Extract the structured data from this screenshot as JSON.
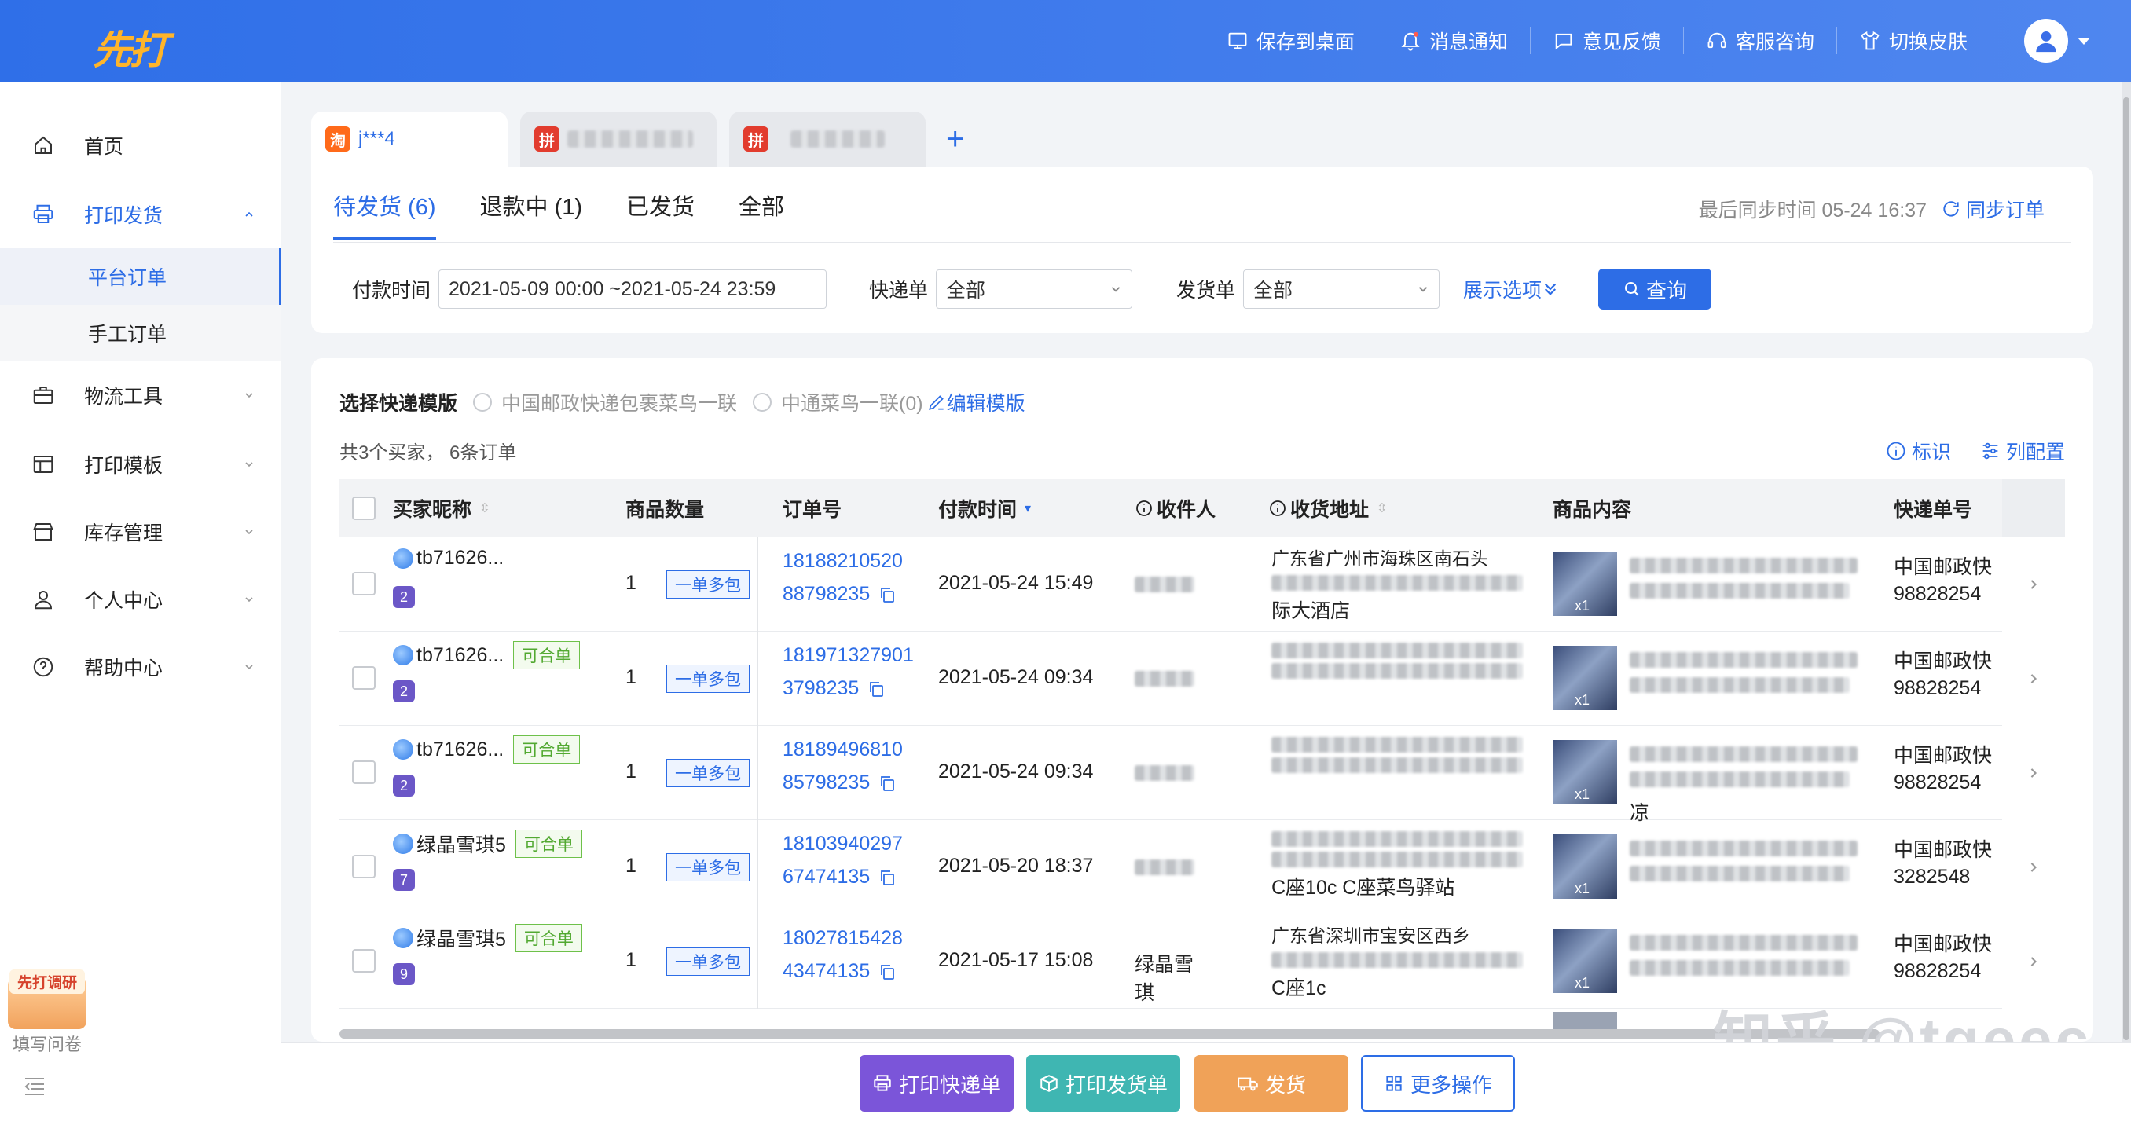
{
  "app": {
    "logo": "先打"
  },
  "topbar": {
    "actions": [
      "保存到桌面",
      "消息通知",
      "意见反馈",
      "客服咨询",
      "切换皮肤"
    ]
  },
  "sidebar": {
    "items": [
      "首页",
      "打印发货",
      "物流工具",
      "打印模板",
      "库存管理",
      "个人中心",
      "帮助中心"
    ],
    "sub": [
      "平台订单",
      "手工订单"
    ],
    "survey_badge": "先打调研",
    "survey_label": "填写问卷"
  },
  "shops": [
    {
      "badge": "淘",
      "name": "j***4"
    },
    {
      "badge": "拼",
      "name": ""
    },
    {
      "badge": "拼",
      "name": ""
    }
  ],
  "status_tabs": [
    "待发货 (6)",
    "退款中 (1)",
    "已发货",
    "全部"
  ],
  "sync": {
    "text": "最后同步时间 05-24 16:37",
    "link": "同步订单"
  },
  "filter": {
    "pay_label": "付款时间",
    "pay_value": "2021-05-09 00:00 ~2021-05-24 23:59",
    "express_label": "快递单",
    "express_value": "全部",
    "ship_label": "发货单",
    "ship_value": "全部",
    "options": "展示选项",
    "query": "查询"
  },
  "template": {
    "label": "选择快递模版",
    "opt1": "中国邮政快递包裹菜鸟一联",
    "opt2": "中通菜鸟一联(0)",
    "edit": "编辑模版"
  },
  "summary": "共3个买家，  6条订单",
  "links": {
    "mark": "标识",
    "cols": "列配置"
  },
  "table": {
    "headers": [
      "买家昵称",
      "商品数量",
      "订单号",
      "付款时间",
      "收件人",
      "收货地址",
      "商品内容",
      "快递单号"
    ],
    "rows": [
      {
        "buyer": "tb71626...",
        "badge": "2",
        "merge": "",
        "qty": "1",
        "tag": "一单多包",
        "order1": "18188210520",
        "order2": "88798235",
        "time": "2021-05-24 15:49",
        "recipient": "",
        "addr_top": "广东省广州市海珠区南石头",
        "addr_bot": "际大酒店",
        "goods_bot": "",
        "express": "中国邮政快",
        "exno": "98828254"
      },
      {
        "buyer": "tb71626...",
        "badge": "2",
        "merge": "可合单",
        "qty": "1",
        "tag": "一单多包",
        "order1": "181971327901",
        "order2": "3798235",
        "time": "2021-05-24 09:34",
        "recipient": "",
        "addr_top": "",
        "addr_bot": "",
        "goods_bot": "",
        "express": "中国邮政快",
        "exno": "98828254"
      },
      {
        "buyer": "tb71626...",
        "badge": "2",
        "merge": "可合单",
        "qty": "1",
        "tag": "一单多包",
        "order1": "18189496810",
        "order2": "85798235",
        "time": "2021-05-24 09:34",
        "recipient": "",
        "addr_top": "",
        "addr_bot": "",
        "goods_bot": "凉",
        "express": "中国邮政快",
        "exno": "98828254"
      },
      {
        "buyer": "绿晶雪琪5",
        "badge": "7",
        "merge": "可合单",
        "qty": "1",
        "tag": "一单多包",
        "order1": "18103940297",
        "order2": "67474135",
        "time": "2021-05-20 18:37",
        "recipient": "",
        "addr_top": "",
        "addr_bot": "C座10c C座菜鸟驿站",
        "goods_bot": "",
        "express": "中国邮政快",
        "exno": "3282548"
      },
      {
        "buyer": "绿晶雪琪5",
        "badge": "9",
        "merge": "可合单",
        "qty": "1",
        "tag": "一单多包",
        "order1": "18027815428",
        "order2": "43474135",
        "time": "2021-05-17 15:08",
        "recipient": "绿晶雪琪",
        "addr_top": "广东省深圳市宝安区西乡",
        "addr_bot": "C座1c",
        "goods_bot": "",
        "express": "中国邮政快",
        "exno": "98828254"
      }
    ]
  },
  "bottom": {
    "b1": "打印快递单",
    "b2": "打印发货单",
    "b3": "发货",
    "b4": "更多操作",
    "c1": "#7b55d9",
    "c2": "#3fb6b2",
    "c3": "#f0a258",
    "c4": "#2d6de6"
  },
  "watermark": "知乎 @tgeec"
}
